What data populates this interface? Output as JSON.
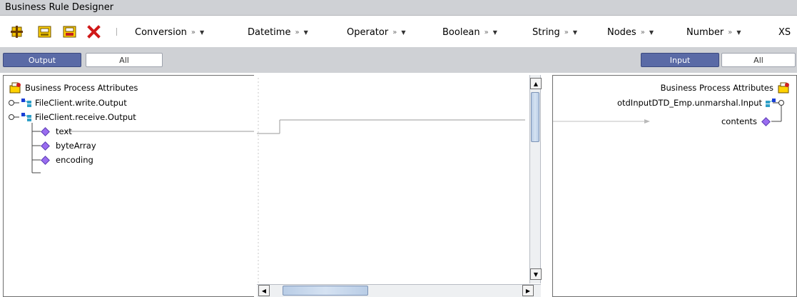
{
  "window": {
    "title": "Business Rule Designer"
  },
  "toolbar": {
    "icons": [
      "add-node-icon",
      "calendar-icon",
      "save-rule-icon",
      "delete-icon"
    ],
    "menus": [
      {
        "label": "Conversion"
      },
      {
        "label": "Datetime"
      },
      {
        "label": "Operator"
      },
      {
        "label": "Boolean"
      },
      {
        "label": "String"
      },
      {
        "label": "Nodes"
      },
      {
        "label": "Number"
      },
      {
        "label": "XS"
      }
    ],
    "expand_glyph": "»",
    "dropdown_glyph": "▼"
  },
  "viewbar": {
    "left": {
      "output": "Output",
      "all": "All"
    },
    "right": {
      "input": "Input",
      "all": "All"
    }
  },
  "left_tree": {
    "root": "Business Process Attributes",
    "nodes": [
      {
        "label": "FileClient.write.Output"
      },
      {
        "label": "FileClient.receive.Output"
      }
    ],
    "children": [
      "text",
      "byteArray",
      "encoding"
    ]
  },
  "right_tree": {
    "root": "Business Process Attributes",
    "node": "otdInputDTD_Emp.unmarshal.Input",
    "child": "contents"
  },
  "colors": {
    "accent": "#5a6aa6",
    "diamond": "#9a6cf0",
    "titlebar": "#cfd1d5"
  }
}
